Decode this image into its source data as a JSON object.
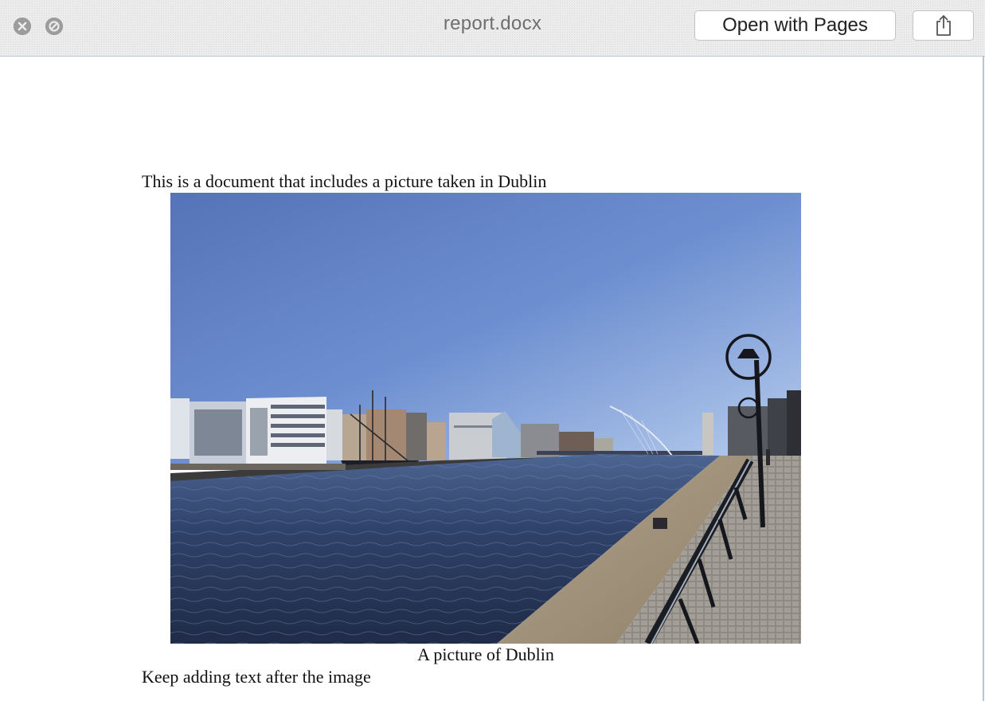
{
  "window": {
    "title": "report.docx",
    "open_button_label": "Open with Pages"
  },
  "icons": {
    "close": "close-icon",
    "disabled": "disabled-icon",
    "share": "share-icon"
  },
  "document": {
    "intro_text": "This is a document that includes a picture taken in Dublin",
    "image": {
      "subject": "River Liffey quayside in Dublin with a tall ship, office buildings and a harp-shaped bridge under a blue sky"
    },
    "caption": "A picture of Dublin",
    "outro_text": "Keep adding text after the image"
  },
  "colors": {
    "titlebar": "#ececec",
    "window_border": "#b9c6d0",
    "title_text": "#6f6f6f",
    "sky_top": "#5f7fc4",
    "water": "#2d3f63"
  }
}
